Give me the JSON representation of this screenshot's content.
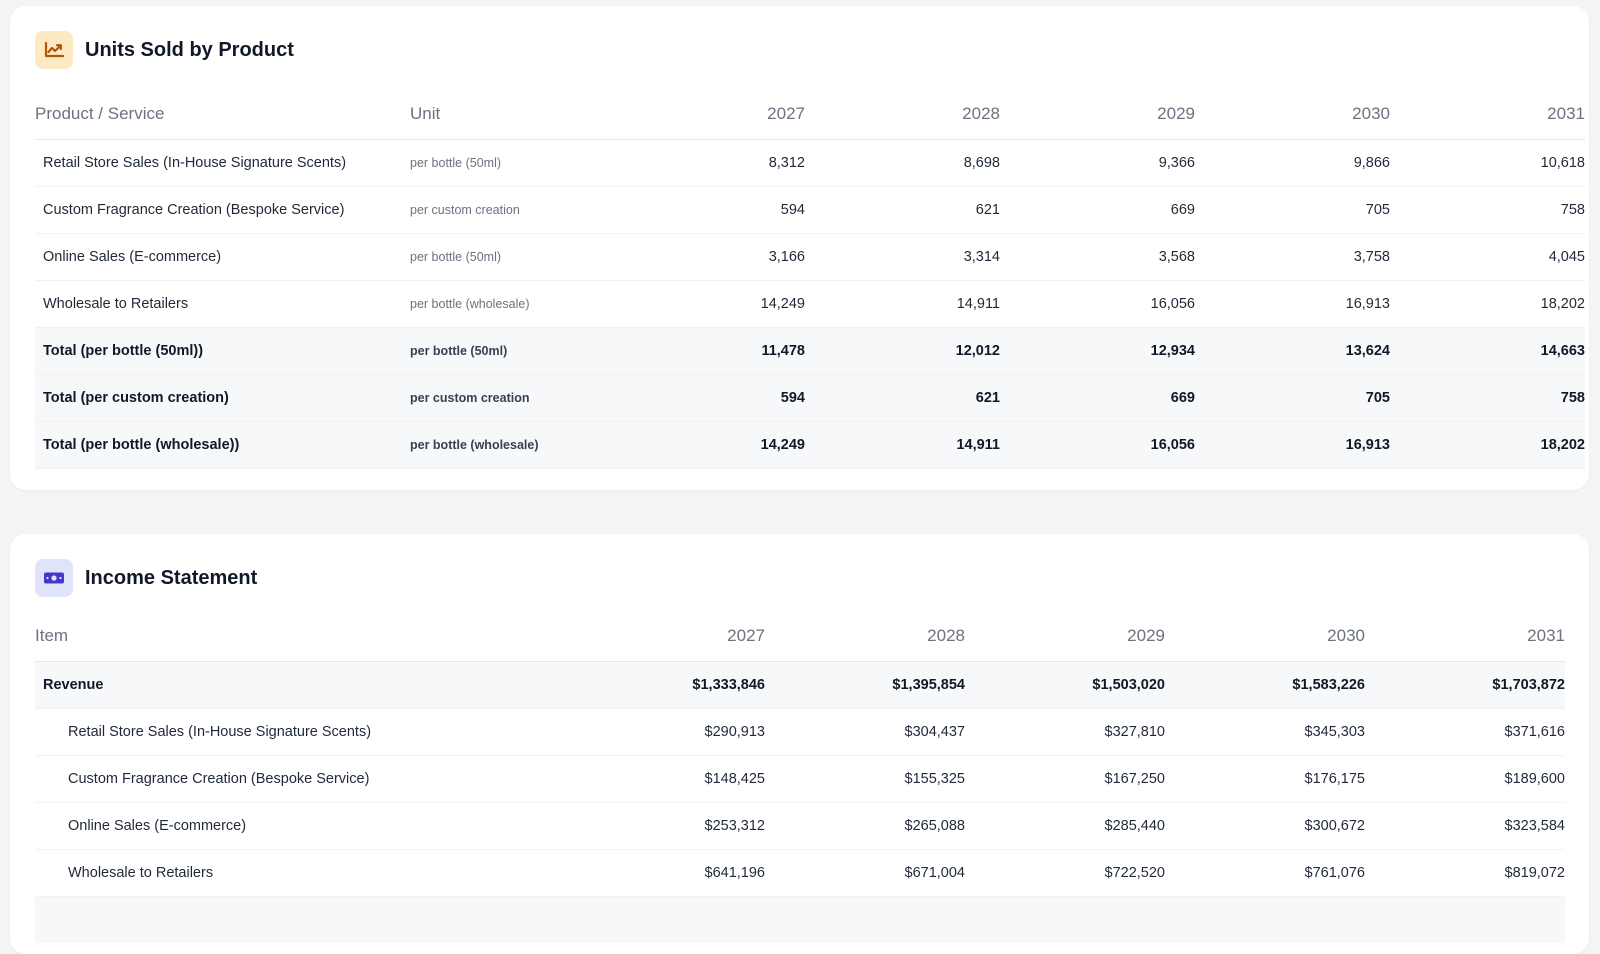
{
  "units_section": {
    "title": "Units Sold by Product",
    "icon": "chart-line-icon",
    "columns": [
      "Product / Service",
      "Unit",
      "2027",
      "2028",
      "2029",
      "2030",
      "2031"
    ],
    "rows": [
      {
        "name": "Retail Store Sales (In-House Signature Scents)",
        "unit": "per bottle (50ml)",
        "values": [
          "8,312",
          "8,698",
          "9,366",
          "9,866",
          "10,618"
        ]
      },
      {
        "name": "Custom Fragrance Creation (Bespoke Service)",
        "unit": "per custom creation",
        "values": [
          "594",
          "621",
          "669",
          "705",
          "758"
        ]
      },
      {
        "name": "Online Sales (E-commerce)",
        "unit": "per bottle (50ml)",
        "values": [
          "3,166",
          "3,314",
          "3,568",
          "3,758",
          "4,045"
        ]
      },
      {
        "name": "Wholesale to Retailers",
        "unit": "per bottle (wholesale)",
        "values": [
          "14,249",
          "14,911",
          "16,056",
          "16,913",
          "18,202"
        ]
      }
    ],
    "totals": [
      {
        "name": "Total (per bottle (50ml))",
        "unit": "per bottle (50ml)",
        "values": [
          "11,478",
          "12,012",
          "12,934",
          "13,624",
          "14,663"
        ]
      },
      {
        "name": "Total (per custom creation)",
        "unit": "per custom creation",
        "values": [
          "594",
          "621",
          "669",
          "705",
          "758"
        ]
      },
      {
        "name": "Total (per bottle (wholesale))",
        "unit": "per bottle (wholesale)",
        "values": [
          "14,249",
          "14,911",
          "16,056",
          "16,913",
          "18,202"
        ]
      }
    ]
  },
  "income_section": {
    "title": "Income Statement",
    "icon": "money-icon",
    "columns": [
      "Item",
      "2027",
      "2028",
      "2029",
      "2030",
      "2031"
    ],
    "revenue": {
      "name": "Revenue",
      "values": [
        "$1,333,846",
        "$1,395,854",
        "$1,503,020",
        "$1,583,226",
        "$1,703,872"
      ]
    },
    "rows": [
      {
        "name": "Retail Store Sales (In-House Signature Scents)",
        "values": [
          "$290,913",
          "$304,437",
          "$327,810",
          "$345,303",
          "$371,616"
        ]
      },
      {
        "name": "Custom Fragrance Creation (Bespoke Service)",
        "values": [
          "$148,425",
          "$155,325",
          "$167,250",
          "$176,175",
          "$189,600"
        ]
      },
      {
        "name": "Online Sales (E-commerce)",
        "values": [
          "$253,312",
          "$265,088",
          "$285,440",
          "$300,672",
          "$323,584"
        ]
      },
      {
        "name": "Wholesale to Retailers",
        "values": [
          "$641,196",
          "$671,004",
          "$722,520",
          "$761,076",
          "$819,072"
        ]
      }
    ]
  },
  "colors": {
    "units_icon_bg": "#fde9c4",
    "units_icon_fg": "#b45309",
    "income_icon_bg": "#e0e4fb",
    "income_icon_fg": "#4338ca"
  }
}
